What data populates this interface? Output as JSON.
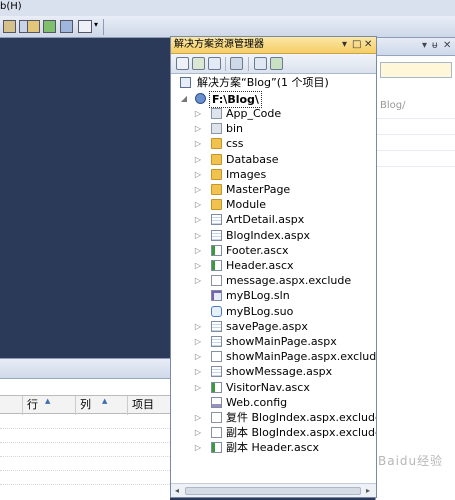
{
  "menubar": {
    "text": "b(H)"
  },
  "solution_explorer": {
    "title": "解决方案资源管理器",
    "controls": {
      "dropdown": "▾",
      "pin": "□",
      "close": "✕"
    },
    "solution_label": "解决方案“Blog”(1 个项目)",
    "project_label": "F:\\Blog\\",
    "items": [
      {
        "label": "App_Code",
        "icon": "folder-special-icon",
        "expander": "▷"
      },
      {
        "label": "bin",
        "icon": "folder-special-icon",
        "expander": "▷"
      },
      {
        "label": "css",
        "icon": "folder-icon",
        "expander": "▷"
      },
      {
        "label": "Database",
        "icon": "folder-icon",
        "expander": "▷"
      },
      {
        "label": "Images",
        "icon": "folder-icon",
        "expander": "▷"
      },
      {
        "label": "MasterPage",
        "icon": "folder-icon",
        "expander": "▷"
      },
      {
        "label": "Module",
        "icon": "folder-icon",
        "expander": "▷"
      },
      {
        "label": "ArtDetail.aspx",
        "icon": "aspx-page-icon",
        "expander": "▷"
      },
      {
        "label": "BlogIndex.aspx",
        "icon": "aspx-page-icon",
        "expander": "▷"
      },
      {
        "label": "Footer.ascx",
        "icon": "user-control-icon",
        "expander": "▷"
      },
      {
        "label": "Header.ascx",
        "icon": "user-control-icon",
        "expander": "▷"
      },
      {
        "label": "message.aspx.exclude",
        "icon": "file-icon",
        "expander": "▷"
      },
      {
        "label": "myBLog.sln",
        "icon": "sln-file-icon",
        "expander": ""
      },
      {
        "label": "myBLog.suo",
        "icon": "suo-file-icon",
        "expander": ""
      },
      {
        "label": "savePage.aspx",
        "icon": "aspx-page-icon",
        "expander": "▷"
      },
      {
        "label": "showMainPage.aspx",
        "icon": "aspx-page-icon",
        "expander": "▷"
      },
      {
        "label": "showMainPage.aspx.exclude",
        "icon": "file-icon",
        "expander": "▷"
      },
      {
        "label": "showMessage.aspx",
        "icon": "aspx-page-icon",
        "expander": "▷"
      },
      {
        "label": "VisitorNav.ascx",
        "icon": "user-control-icon",
        "expander": "▷"
      },
      {
        "label": "Web.config",
        "icon": "config-file-icon",
        "expander": ""
      },
      {
        "label": "复件 BlogIndex.aspx.exclude",
        "icon": "file-icon",
        "expander": "▷"
      },
      {
        "label": "副本 BlogIndex.aspx.exclude",
        "icon": "file-icon",
        "expander": "▷"
      },
      {
        "label": "副本 Header.ascx",
        "icon": "user-control-icon",
        "expander": "▷"
      }
    ],
    "scroll": {
      "left": "◂",
      "right": "▸"
    }
  },
  "properties_window": {
    "title_controls": {
      "dropdown": "▾",
      "pin": "ᵾ",
      "close": "✕"
    },
    "path_text": "Blog/"
  },
  "error_list": {
    "columns": [
      "行",
      "列",
      "项目"
    ],
    "sort_mark": "▲"
  },
  "watermark": "Baidu经验",
  "colors": {
    "editor_background": "#2b3a59",
    "active_title": "#f5cd66",
    "folder": "#f1c24d"
  }
}
